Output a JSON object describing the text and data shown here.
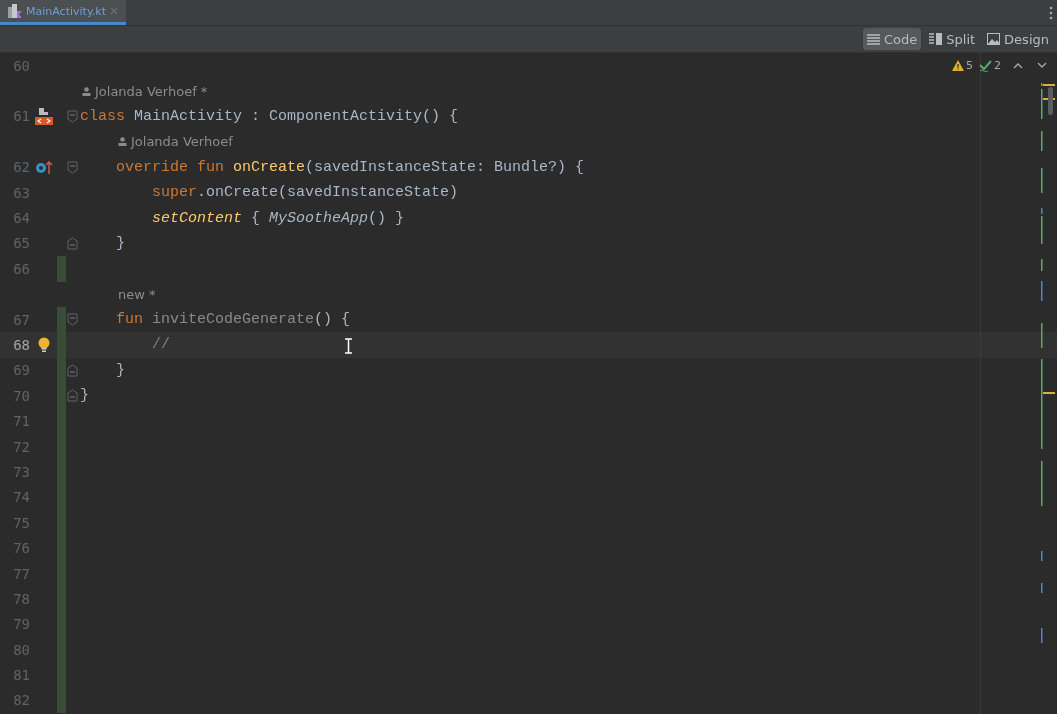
{
  "tabs": [
    {
      "label": "MainActivity.kt",
      "selected": true
    }
  ],
  "view_modes": [
    {
      "label": "Code",
      "kind": "code",
      "selected": true
    },
    {
      "label": "Split",
      "kind": "split",
      "selected": false
    },
    {
      "label": "Design",
      "kind": "design",
      "selected": false
    }
  ],
  "inspections": {
    "warnings": "5",
    "weak_warnings": "2"
  },
  "editor": {
    "lines": [
      {
        "kind": "line",
        "number": "60",
        "changed": false,
        "current": false
      },
      {
        "kind": "annotation",
        "text": "Jolanda Verhoef *",
        "person": true
      },
      {
        "kind": "line",
        "number": "61",
        "gutter_icon": {
          "kind": "implemented"
        },
        "fold": {
          "kind": "start"
        },
        "changed": false,
        "current": false,
        "tokens": [
          {
            "text": "class ",
            "kind": "keyword"
          },
          {
            "text": "MainActivity : ComponentActivity() {",
            "kind": "plain"
          }
        ],
        "children": [
          {
            "kind": "annotation",
            "text": "Jolanda Verhoef",
            "person": true
          },
          {
            "kind": "line",
            "number": "62",
            "gutter_icon": {
              "kind": "overrides"
            },
            "fold": {
              "kind": "start"
            },
            "changed": false,
            "current": false,
            "tokens": [
              {
                "text": "override fun ",
                "kind": "keyword"
              },
              {
                "text": "onCreate",
                "kind": "declaration"
              },
              {
                "text": "(savedInstanceState: Bundle?) {",
                "kind": "plain"
              }
            ],
            "children": [
              {
                "kind": "line",
                "number": "63",
                "changed": false,
                "current": false,
                "tokens": [
                  {
                    "text": "super",
                    "kind": "keyword"
                  },
                  {
                    "text": ".onCreate(savedInstanceState)",
                    "kind": "plain"
                  }
                ]
              },
              {
                "kind": "line",
                "number": "64",
                "changed": false,
                "current": false,
                "tokens": [
                  {
                    "text": "setContent",
                    "kind": "call"
                  },
                  {
                    "text": " { ",
                    "kind": "plain"
                  },
                  {
                    "text": "MySootheApp",
                    "kind": "italic"
                  },
                  {
                    "text": "() }",
                    "kind": "plain"
                  }
                ]
              }
            ]
          },
          {
            "kind": "line",
            "number": "65",
            "fold": {
              "kind": "end"
            },
            "changed": false,
            "current": false,
            "tokens": [
              {
                "text": "}",
                "kind": "plain"
              }
            ]
          },
          {
            "kind": "line",
            "number": "66",
            "changed": true,
            "current": false
          },
          {
            "kind": "annotation",
            "text": "new *",
            "person": false
          },
          {
            "kind": "line",
            "number": "67",
            "fold": {
              "kind": "start"
            },
            "changed": true,
            "current": false,
            "tokens": [
              {
                "text": "fun ",
                "kind": "keyword"
              },
              {
                "text": "inviteCodeGenerate",
                "kind": "unused"
              },
              {
                "text": "() {",
                "kind": "plain"
              }
            ],
            "children": [
              {
                "kind": "line",
                "number": "68",
                "gutter_icon": {
                  "kind": "bulb"
                },
                "changed": true,
                "current": true,
                "tokens": [
                  {
                    "text": "//",
                    "kind": "comment"
                  }
                ]
              }
            ]
          },
          {
            "kind": "line",
            "number": "69",
            "fold": {
              "kind": "end"
            },
            "changed": true,
            "current": false,
            "tokens": [
              {
                "text": "}",
                "kind": "plain"
              }
            ]
          }
        ]
      },
      {
        "kind": "line",
        "number": "70",
        "fold": {
          "kind": "end"
        },
        "changed": true,
        "current": false,
        "tokens": [
          {
            "text": "}",
            "kind": "plain"
          }
        ]
      },
      {
        "kind": "line",
        "number": "71",
        "changed": true,
        "current": false
      },
      {
        "kind": "line",
        "number": "72",
        "changed": true,
        "current": false
      },
      {
        "kind": "line",
        "number": "73",
        "changed": true,
        "current": false
      },
      {
        "kind": "line",
        "number": "74",
        "changed": true,
        "current": false
      },
      {
        "kind": "line",
        "number": "75",
        "changed": true,
        "current": false
      },
      {
        "kind": "line",
        "number": "76",
        "changed": true,
        "current": false
      },
      {
        "kind": "line",
        "number": "77",
        "changed": true,
        "current": false
      },
      {
        "kind": "line",
        "number": "78",
        "changed": true,
        "current": false
      },
      {
        "kind": "line",
        "number": "79",
        "changed": true,
        "current": false
      },
      {
        "kind": "line",
        "number": "80",
        "changed": true,
        "current": false
      },
      {
        "kind": "line",
        "number": "81",
        "changed": true,
        "current": false
      },
      {
        "kind": "line",
        "number": "82",
        "changed": true,
        "current": false
      }
    ]
  }
}
